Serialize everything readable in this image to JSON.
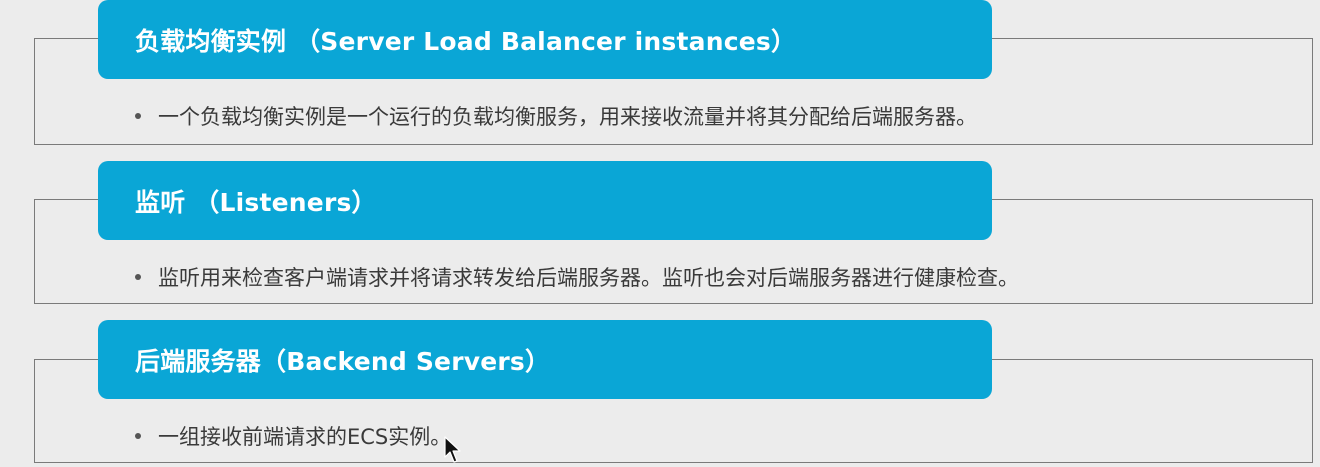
{
  "sections": [
    {
      "title": "负载均衡实例  （Server Load Balancer instances）",
      "bullet": "一个负载均衡实例是一个运行的负载均衡服务，用来接收流量并将其分配给后端服务器。"
    },
    {
      "title": "监听  （Listeners）",
      "bullet": "监听用来检查客户端请求并将请求转发给后端服务器。监听也会对后端服务器进行健康检查。"
    },
    {
      "title": "后端服务器（Backend Servers）",
      "bullet": "一组接收前端请求的ECS实例。"
    }
  ],
  "colors": {
    "header_bg": "#0aa6d6",
    "page_bg": "#ececec",
    "frame_border": "#7a7a7a",
    "text": "#3a3a3a"
  },
  "icons": {
    "cursor": "mouse-pointer-icon"
  }
}
